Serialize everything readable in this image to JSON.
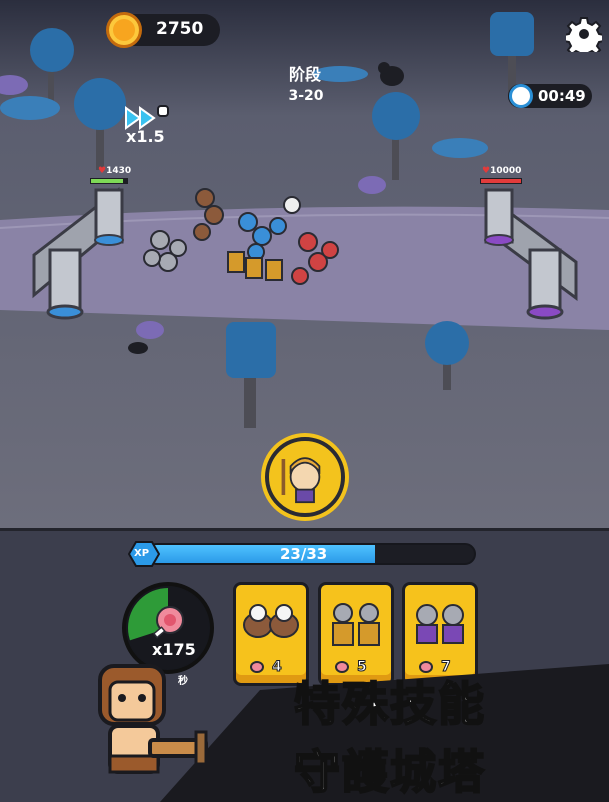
{
  "hud": {
    "coins": "2750",
    "stage_label": "阶段",
    "stage_value": "3-20",
    "timer": "00:49",
    "speed": "x1.5"
  },
  "castles": {
    "player_hp": "1430",
    "enemy_hp": "10000"
  },
  "xp": {
    "label": "XP",
    "value": "23/33",
    "progress": 0.697
  },
  "resource": {
    "meat_count": "x175",
    "per_second_label": "秒",
    "gauge_fill": 0.3
  },
  "unit_cards": [
    {
      "icon": "griffin-riders-icon",
      "cost": "4"
    },
    {
      "icon": "shield-knights-icon",
      "cost": "5"
    },
    {
      "icon": "purple-soldiers-icon",
      "cost": "7"
    }
  ],
  "promo": {
    "line1": "特殊技能",
    "line2": "守護城塔"
  },
  "icons": {
    "settings": "gear-icon",
    "coin": "coin-icon",
    "timer": "timer-icon",
    "speed": "fast-forward-icon",
    "hero": "hero-portrait-icon"
  },
  "colors": {
    "ground": "#6e6f7f",
    "road": "#8b84a8",
    "player_tower_accent": "#3a8fd8",
    "enemy_tower_accent": "#8a4ac4",
    "card": "#f6c21c",
    "xp_fill": "#3aaef3"
  }
}
